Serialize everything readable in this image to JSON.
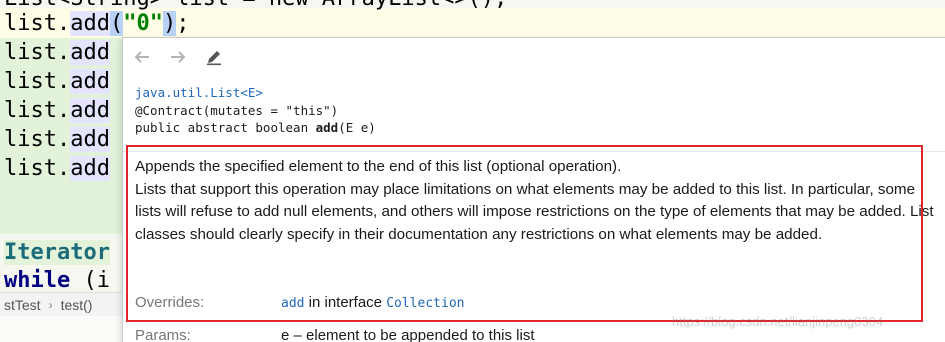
{
  "editor": {
    "partial_top": "List<String> list = new ArrayList<>();",
    "first_line": {
      "prefix": "list.",
      "method": "add",
      "open": "(",
      "arg": "\"0\"",
      "close": ")",
      "semi": ";"
    },
    "repeated_prefix": "list.",
    "repeated_method": "add",
    "repeated_count": 5,
    "iterator_line": "Iterator",
    "while_keyword": "while",
    "while_rest": " (i"
  },
  "breadcrumb": {
    "items": [
      "stTest",
      "test()"
    ],
    "separator": "›"
  },
  "popup": {
    "toolbar": {
      "back_icon": "arrow-left-icon",
      "forward_icon": "arrow-right-icon",
      "edit_icon": "pencil-icon"
    },
    "signature": {
      "class_ref": "java.util.List<E>",
      "annotation": "@Contract(mutates = \"this\")",
      "decl_prefix": "public abstract boolean ",
      "method": "add",
      "decl_suffix": "(E e)"
    },
    "description": "Appends the specified element to the end of this list (optional operation).",
    "description_2": "Lists that support this operation may place limitations on what elements may be added to this list. In particular, some lists will refuse to add null elements, and others will impose restrictions on the type of elements that may be added. List classes should clearly specify in their documentation any restrictions on what elements may be added.",
    "overrides_label": "Overrides:",
    "overrides_method": "add",
    "overrides_text": " in interface ",
    "overrides_class": "Collection",
    "params_label": "Params:",
    "params_value": "e – element to be appended to this list"
  },
  "annotation_box_color": "#e0252c",
  "watermark": "https://blog.csdn.net/lianjinpeng0304"
}
